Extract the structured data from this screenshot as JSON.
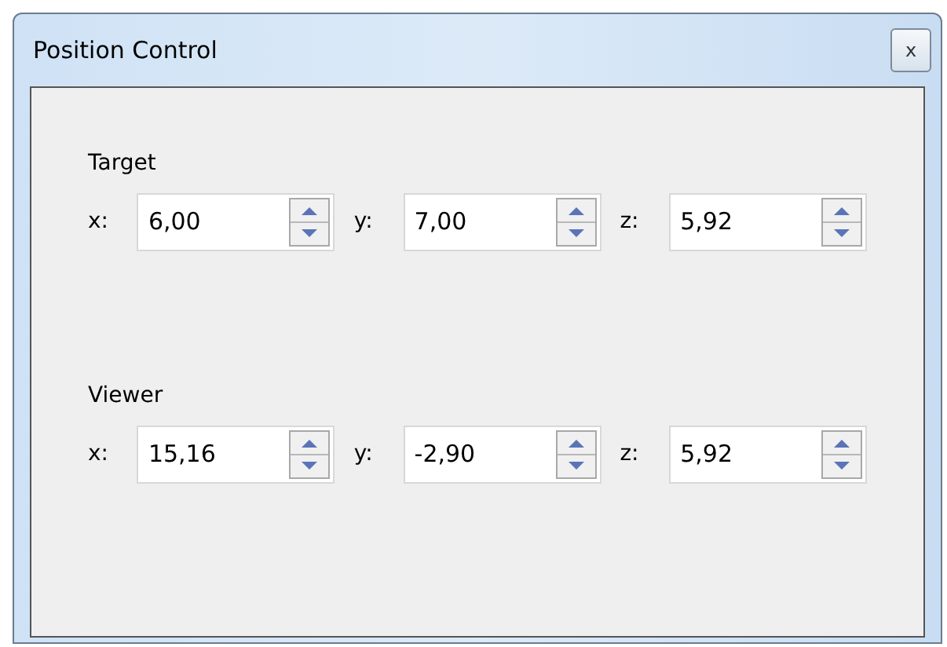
{
  "window": {
    "title": "Position Control",
    "close": "x"
  },
  "groups": [
    {
      "label": "Target",
      "fields": [
        {
          "label": "x:",
          "value": "6,00"
        },
        {
          "label": "y:",
          "value": "7,00"
        },
        {
          "label": "z:",
          "value": "5,92"
        }
      ]
    },
    {
      "label": "Viewer",
      "fields": [
        {
          "label": "x:",
          "value": "15,16"
        },
        {
          "label": "y:",
          "value": "-2,90"
        },
        {
          "label": "z:",
          "value": "5,92"
        }
      ]
    }
  ]
}
